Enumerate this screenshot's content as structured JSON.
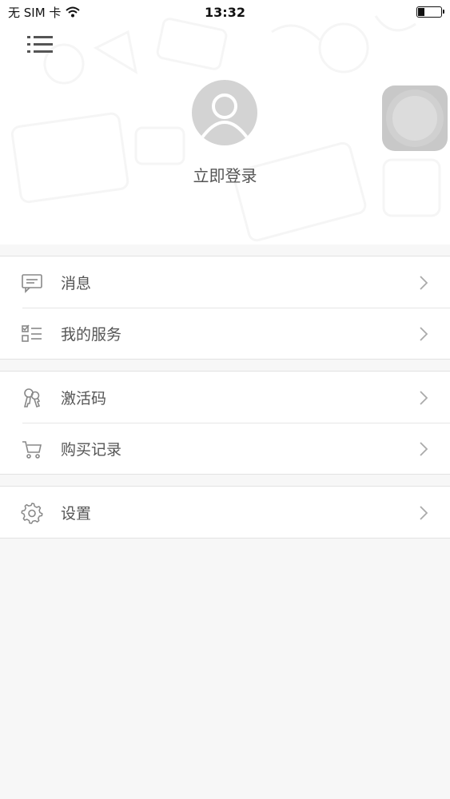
{
  "status_bar": {
    "carrier": "无 SIM 卡",
    "time": "13:32"
  },
  "header": {
    "login_label": "立即登录"
  },
  "menu": {
    "groups": [
      {
        "items": [
          {
            "label": "消息",
            "icon": "message-icon"
          },
          {
            "label": "我的服务",
            "icon": "service-list-icon"
          }
        ]
      },
      {
        "items": [
          {
            "label": "激活码",
            "icon": "key-icon"
          },
          {
            "label": "购买记录",
            "icon": "cart-icon"
          }
        ]
      },
      {
        "items": [
          {
            "label": "设置",
            "icon": "gear-icon"
          }
        ]
      }
    ]
  },
  "colors": {
    "background": "#f7f7f7",
    "avatar": "#d3d3d3",
    "text": "#555555",
    "icon": "#888888"
  }
}
